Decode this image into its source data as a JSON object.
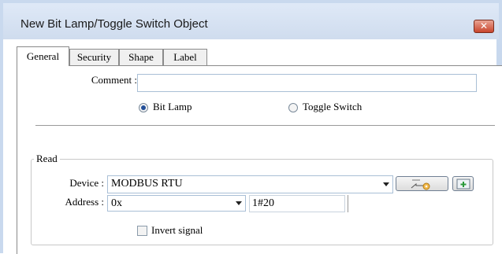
{
  "window": {
    "title": "New Bit Lamp/Toggle Switch Object",
    "close_glyph": "✕"
  },
  "tabs": [
    {
      "label": "General",
      "active": true
    },
    {
      "label": "Security",
      "active": false
    },
    {
      "label": "Shape",
      "active": false
    },
    {
      "label": "Label",
      "active": false
    }
  ],
  "general": {
    "comment_label": "Comment :",
    "comment_value": "",
    "type_options": [
      {
        "label": "Bit Lamp",
        "selected": true
      },
      {
        "label": "Toggle Switch",
        "selected": false
      }
    ]
  },
  "read_group": {
    "title": "Read",
    "device_label": "Device :",
    "device_value": "MODBUS RTU",
    "settings_icon": "settings-icon",
    "add_icon": "add-icon",
    "address_label": "Address :",
    "address_type_value": "0x",
    "address_value": "1#20",
    "invert_label": "Invert signal",
    "invert_checked": false
  },
  "colors": {
    "title_bar": "#cfdcee",
    "close_button": "#c9452c",
    "radio_dot": "#234f99"
  }
}
